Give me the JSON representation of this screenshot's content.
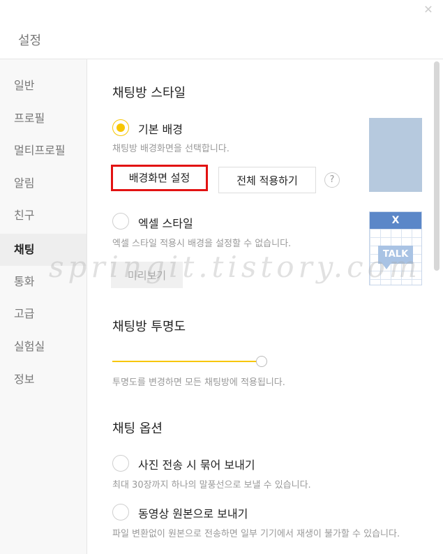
{
  "window": {
    "title": "설정",
    "close_icon": "close-icon"
  },
  "sidebar": {
    "items": [
      {
        "label": "일반",
        "active": false
      },
      {
        "label": "프로필",
        "active": false
      },
      {
        "label": "멀티프로필",
        "active": false
      },
      {
        "label": "알림",
        "active": false
      },
      {
        "label": "친구",
        "active": false
      },
      {
        "label": "채팅",
        "active": true
      },
      {
        "label": "통화",
        "active": false
      },
      {
        "label": "고급",
        "active": false
      },
      {
        "label": "실험실",
        "active": false
      },
      {
        "label": "정보",
        "active": false
      }
    ]
  },
  "chat_style": {
    "title": "채팅방 스타일",
    "default_bg": {
      "label": "기본 배경",
      "checked": true,
      "desc": "채팅방 배경화면을 선택합니다."
    },
    "set_bg_button": "배경화면 설정",
    "apply_all_button": "전체 적용하기",
    "help_label": "?",
    "excel_style": {
      "label": "엑셀 스타일",
      "checked": false,
      "desc": "엑셀 스타일 적용시 배경을 설정할 수 없습니다."
    },
    "preview_button": "미리보기",
    "excel_preview": {
      "logo": "X",
      "talk": "TALK"
    },
    "preview_bg_color": "#b6c9de"
  },
  "transparency": {
    "title": "채팅방 투명도",
    "value_fraction": 1.0,
    "desc": "투명도를 변경하면 모든 채팅방에 적용됩니다."
  },
  "chat_options": {
    "title": "채팅 옵션",
    "photo_bundle": {
      "label": "사진 전송 시 묶어 보내기",
      "checked": false,
      "desc": "최대 30장까지 하나의 말풍선으로 보낼 수 있습니다."
    },
    "video_original": {
      "label": "동영상 원본으로 보내기",
      "checked": false,
      "desc": "파일 변환없이 원본으로 전송하면 일부 기기에서 재생이 불가할 수 있습니다."
    }
  },
  "watermark": "springit.tistory.com",
  "colors": {
    "accent": "#f7c600",
    "highlight": "#e21212"
  }
}
